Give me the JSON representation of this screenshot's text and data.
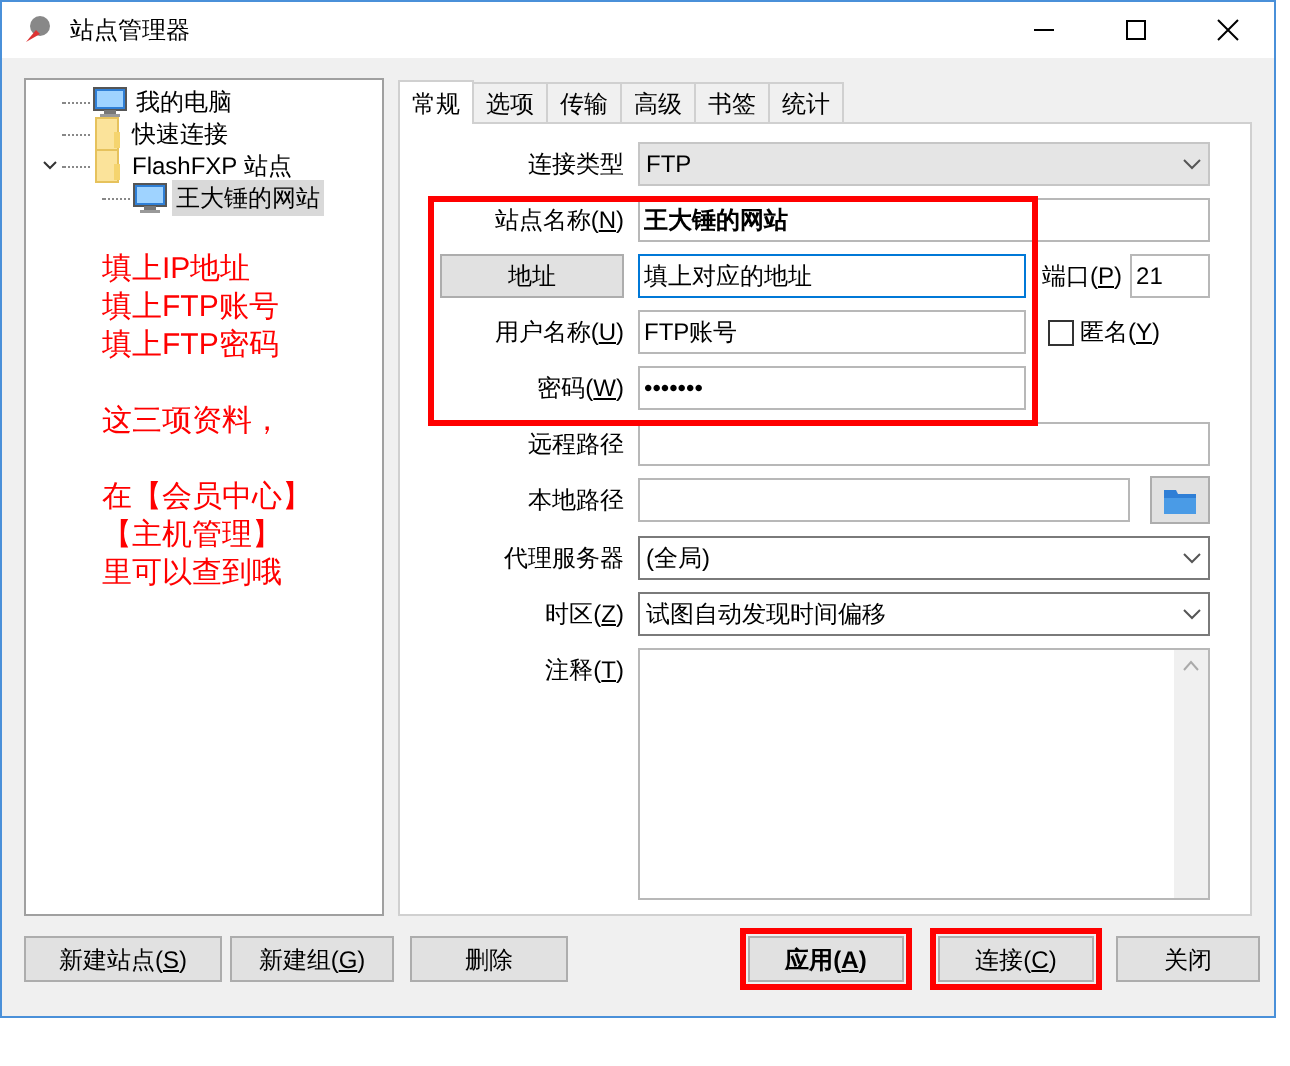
{
  "window": {
    "title": "站点管理器"
  },
  "tree": [
    {
      "label": "我的电脑",
      "kind": "computer",
      "selected": false
    },
    {
      "label": "快速连接",
      "kind": "folder",
      "selected": false
    },
    {
      "label": "FlashFXP 站点",
      "kind": "folder",
      "selected": false,
      "expanded": true,
      "children": [
        {
          "label": "王大锤的网站",
          "kind": "computer",
          "selected": true
        }
      ]
    }
  ],
  "notes": [
    {
      "lines": [
        "填上IP地址",
        "填上FTP账号",
        "填上FTP密码"
      ]
    },
    {
      "lines": [
        "这三项资料，"
      ]
    },
    {
      "lines": [
        "在【会员中心】",
        "【主机管理】",
        "里可以查到哦"
      ]
    }
  ],
  "tabs": [
    {
      "label": "常规",
      "selected": true
    },
    {
      "label": "选项",
      "selected": false
    },
    {
      "label": "传输",
      "selected": false
    },
    {
      "label": "高级",
      "selected": false
    },
    {
      "label": "书签",
      "selected": false
    },
    {
      "label": "统计",
      "selected": false
    }
  ],
  "form": {
    "highlight_frame": true,
    "rows": [
      {
        "kind": "select",
        "label": "连接类型",
        "value": "FTP",
        "disabled": true
      },
      {
        "kind": "text",
        "label_parts": [
          "站点名称(",
          "N",
          ")"
        ],
        "value": "王大锤的网站",
        "bold": true
      },
      {
        "kind": "address",
        "button": "地址",
        "value": "填上对应的地址",
        "focused": true,
        "port_label_parts": [
          "端口(",
          "P",
          ")"
        ],
        "port": "21"
      },
      {
        "kind": "user",
        "label_parts": [
          "用户名称(",
          "U",
          ")"
        ],
        "value": "FTP账号",
        "checkbox_parts": [
          "匿名(",
          "Y",
          ")"
        ],
        "checked": false
      },
      {
        "kind": "password",
        "label_parts": [
          "密码(",
          "W",
          ")"
        ],
        "value": "•••••••"
      },
      {
        "kind": "text",
        "label": "远程路径",
        "value": ""
      },
      {
        "kind": "folder",
        "label": "本地路径",
        "value": ""
      },
      {
        "kind": "select",
        "label": "代理服务器",
        "value": "(全局)",
        "disabled": false
      },
      {
        "kind": "select",
        "label_parts": [
          "时区(",
          "Z",
          ")"
        ],
        "value": "试图自动发现时间偏移",
        "disabled": false
      },
      {
        "kind": "notes",
        "label_parts": [
          "注释(",
          "T",
          ")"
        ],
        "value": ""
      }
    ]
  },
  "buttons": [
    {
      "label_parts": [
        "新建站点(",
        "S",
        ")"
      ],
      "highlighted": false,
      "bold": false
    },
    {
      "label_parts": [
        "新建组(",
        "G",
        ")"
      ],
      "highlighted": false,
      "bold": false
    },
    {
      "label": "删除",
      "highlighted": false,
      "bold": false
    },
    {
      "label_parts": [
        "应用(",
        "A",
        ")"
      ],
      "highlighted": true,
      "bold": true
    },
    {
      "label_parts": [
        "连接(",
        "C",
        ")"
      ],
      "highlighted": true,
      "bold": false
    },
    {
      "label": "关闭",
      "highlighted": false,
      "bold": false
    }
  ]
}
